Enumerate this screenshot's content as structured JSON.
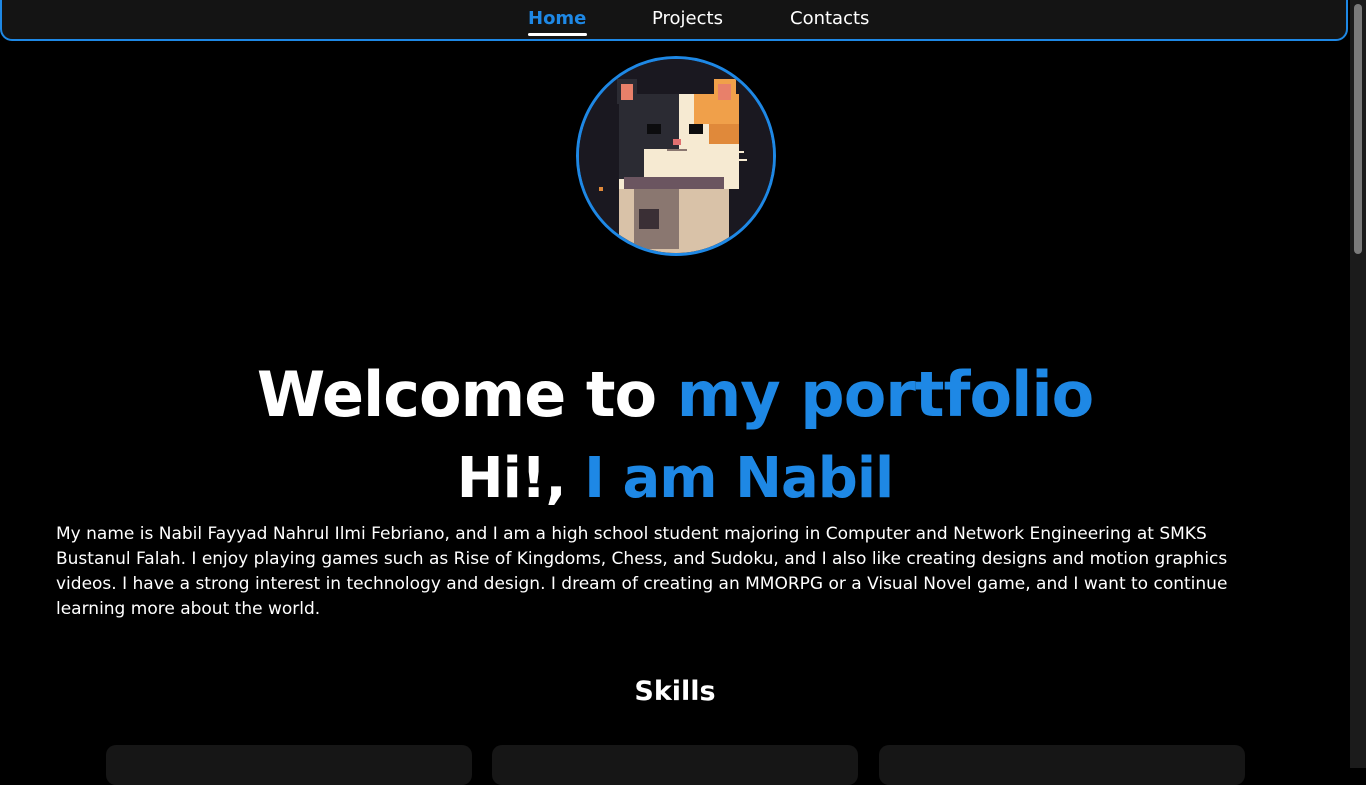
{
  "nav": {
    "items": [
      {
        "label": "Home",
        "active": true
      },
      {
        "label": "Projects",
        "active": false
      },
      {
        "label": "Contacts",
        "active": false
      }
    ]
  },
  "hero": {
    "avatar_icon": "pixel-cat-avatar",
    "title_white": "Welcome to ",
    "title_accent": "my portfolio",
    "greeting_white": "Hi!, ",
    "greeting_accent": "I am Nabil",
    "bio": "My name is Nabil Fayyad Nahrul Ilmi Febriano, and I am a high school student majoring in Computer and Network Engineering at SMKS Bustanul Falah. I enjoy playing games such as Rise of Kingdoms, Chess, and Sudoku, and I also like creating designs and motion graphics videos. I have a strong interest in technology and design. I dream of creating an MMORPG or a Visual Novel game, and I want to continue learning more about the world."
  },
  "skills": {
    "title": "Skills"
  },
  "colors": {
    "accent": "#1e88e5",
    "background": "#000000",
    "navbar": "#141414",
    "card": "#161616"
  }
}
